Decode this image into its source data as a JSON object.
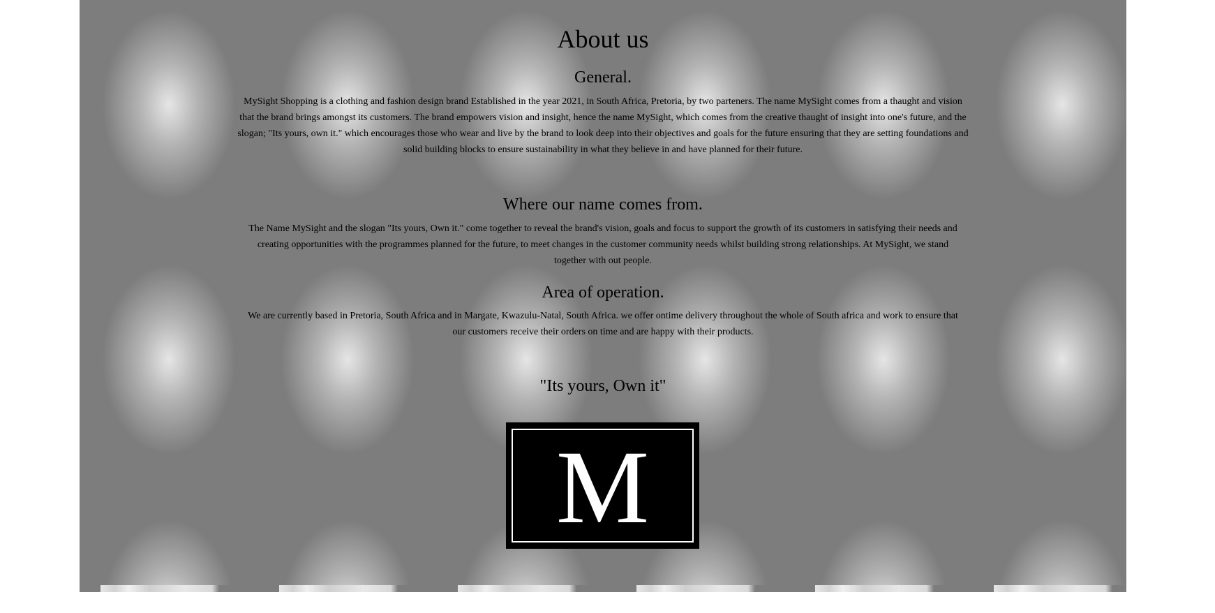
{
  "page": {
    "title": "About us"
  },
  "sections": [
    {
      "heading": "General.",
      "body": "MySight Shopping is a clothing and fashion design brand Established in the year 2021, in South Africa, Pretoria, by two parteners.  The name MySight comes from a thaught and vision that the brand brings amongst its customers.  The brand empowers vision and insight, hence the name MySight, which comes from the creative thaught of insight into one's future,  and the slogan;  \"Its yours, own it.\" which encourages those who wear and live by the brand to look deep into their objectives and goals for the future ensuring that they are setting foundations and solid building blocks to ensure sustainability in what they believe in and have planned for their future."
    },
    {
      "heading": "Where our name comes from.",
      "body": "The Name MySight and the slogan \"Its yours, Own it.\" come together to reveal the brand's vision,  goals and focus to support the growth of its customers in satisfying their needs and creating opportunities with the programmes planned for the future,   to meet changes in the customer community needs whilst building strong relationships.  At MySight,  we stand together with out people."
    },
    {
      "heading": "Area of operation.",
      "body": "We are currently based in Pretoria, South Africa and in Margate, Kwazulu-Natal, South Africa. we offer ontime delivery throughout the whole of South africa and work to ensure that our customers receive their orders on time and are happy with their products."
    }
  ],
  "slogan": "\"Its yours, Own it\"",
  "logo": {
    "letter": "M",
    "background": "#000000",
    "foreground": "#ffffff"
  },
  "colors": {
    "backdrop": "#7d7d7d",
    "page": "#ffffff",
    "text": "#000000"
  }
}
